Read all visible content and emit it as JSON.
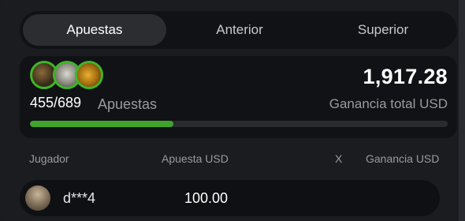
{
  "tabs": [
    {
      "label": "Apuestas",
      "active": true
    },
    {
      "label": "Anterior",
      "active": false
    },
    {
      "label": "Superior",
      "active": false
    }
  ],
  "summary": {
    "bets_count": "455/689",
    "bets_label": "Apuestas",
    "total_win": "1,917.28",
    "total_win_label": "Ganancia total USD",
    "progress_fraction": 0.3434,
    "accent_color": "#3fb52a"
  },
  "table": {
    "headers": {
      "player": "Jugador",
      "bet": "Apuesta USD",
      "multiplier": "X",
      "win": "Ganancia USD"
    },
    "rows": [
      {
        "player": "d***4",
        "bet": "100.00",
        "multiplier": "",
        "win": ""
      }
    ]
  }
}
